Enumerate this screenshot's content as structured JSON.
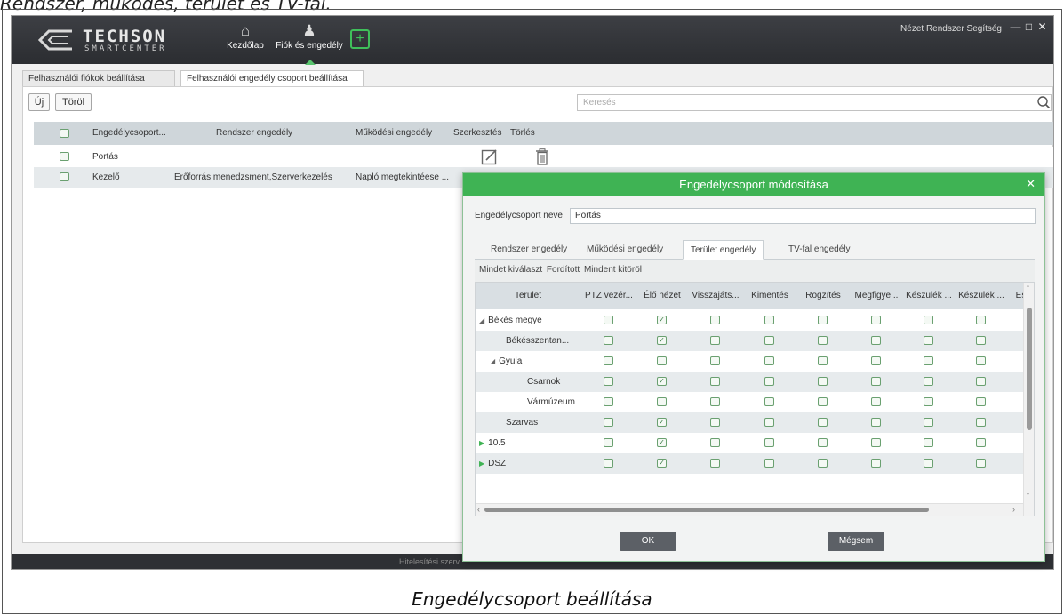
{
  "document": {
    "top_text": "Rendszer, működés, terület és TV-fal.",
    "caption": "Engedélycsoport beállítása"
  },
  "app": {
    "logo_line1": "TECHSON",
    "logo_line2": "SMARTCENTER",
    "nav": [
      {
        "label": "Kezdőlap",
        "icon": "home-icon"
      },
      {
        "label": "Fiók és engedély",
        "icon": "account-icon"
      }
    ],
    "top_menu": "Nézet Rendszer Segítség",
    "status_text": "Hitelesítési szerv"
  },
  "tabs": [
    {
      "label": "Felhasználói fiókok beállítása",
      "active": false
    },
    {
      "label": "Felhasználói engedély csoport beállítása",
      "active": true
    }
  ],
  "toolbar": {
    "new_label": "Új",
    "delete_label": "Töröl",
    "search_placeholder": "Keresés"
  },
  "list": {
    "columns": [
      "Engedélycsoport...",
      "Rendszer engedély",
      "Működési engedély",
      "Szerkesztés",
      "Törlés"
    ],
    "rows": [
      {
        "name": "Portás",
        "system": "",
        "operation": ""
      },
      {
        "name": "Kezelő",
        "system": "Erőforrás menedzsment,Szerverkezelés",
        "operation": "Napló megtekintéese ..."
      }
    ]
  },
  "modal": {
    "title": "Engedélycsoport módosítása",
    "name_label": "Engedélycsoport neve",
    "name_value": "Portás",
    "tabs": [
      "Rendszer engedély",
      "Működési engedély",
      "Terület engedély",
      "TV-fal engedély"
    ],
    "active_tab": 2,
    "select_all": "Mindet kiválaszt",
    "invert": "Fordított",
    "clear_all": "Mindent kitöröl",
    "columns": [
      "Terület",
      "PTZ vezér...",
      "Élő nézet",
      "Visszajáts...",
      "Kimentés",
      "Rögzítés",
      "Megfigye...",
      "Készülék ...",
      "Készülék ...",
      "Esz"
    ],
    "rows": [
      {
        "name": "Békés megye",
        "level": 0,
        "expander": "down",
        "checked": [
          false,
          true,
          false,
          false,
          false,
          false,
          false,
          false
        ]
      },
      {
        "name": "Békésszentan...",
        "level": 1,
        "expander": "",
        "checked": [
          false,
          true,
          false,
          false,
          false,
          false,
          false,
          false
        ]
      },
      {
        "name": "Gyula",
        "level": 1,
        "expander": "down",
        "checked": [
          false,
          false,
          false,
          false,
          false,
          false,
          false,
          false
        ]
      },
      {
        "name": "Csarnok",
        "level": 2,
        "expander": "",
        "checked": [
          false,
          true,
          false,
          false,
          false,
          false,
          false,
          false
        ]
      },
      {
        "name": "Vármúzeum",
        "level": 2,
        "expander": "",
        "checked": [
          false,
          false,
          false,
          false,
          false,
          false,
          false,
          false
        ]
      },
      {
        "name": "Szarvas",
        "level": 1,
        "expander": "",
        "checked": [
          false,
          true,
          false,
          false,
          false,
          false,
          false,
          false
        ]
      },
      {
        "name": "10.5",
        "level": 0,
        "expander": "right",
        "checked": [
          false,
          true,
          false,
          false,
          false,
          false,
          false,
          false
        ]
      },
      {
        "name": "DSZ",
        "level": 0,
        "expander": "right",
        "checked": [
          false,
          true,
          false,
          false,
          false,
          false,
          false,
          false
        ]
      }
    ],
    "ok_label": "OK",
    "cancel_label": "Mégsem"
  }
}
